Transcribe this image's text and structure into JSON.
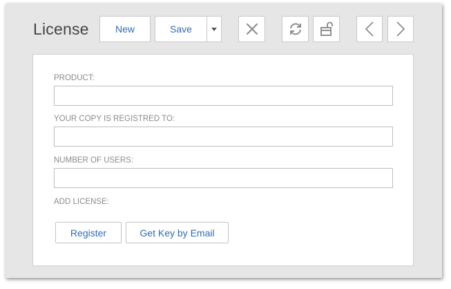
{
  "header": {
    "title": "License"
  },
  "toolbar": {
    "new_label": "New",
    "save_label": "Save",
    "icons": [
      "chevron-down-icon",
      "close-icon",
      "refresh-icon",
      "unlock-icon",
      "chevron-left-icon",
      "chevron-right-icon"
    ]
  },
  "form": {
    "product_label": "PRODUCT:",
    "product_value": "",
    "registered_label": "YOUR COPY IS REGISTRED TO:",
    "registered_value": "",
    "users_label": "NUMBER OF USERS:",
    "users_value": "",
    "add_license_label": "ADD LICENSE:",
    "register_label": "Register",
    "email_key_label": "Get Key by Email"
  },
  "colors": {
    "accent": "#2c6eb5",
    "window_bg": "#e5e6e5",
    "label": "#8a8a8a"
  }
}
